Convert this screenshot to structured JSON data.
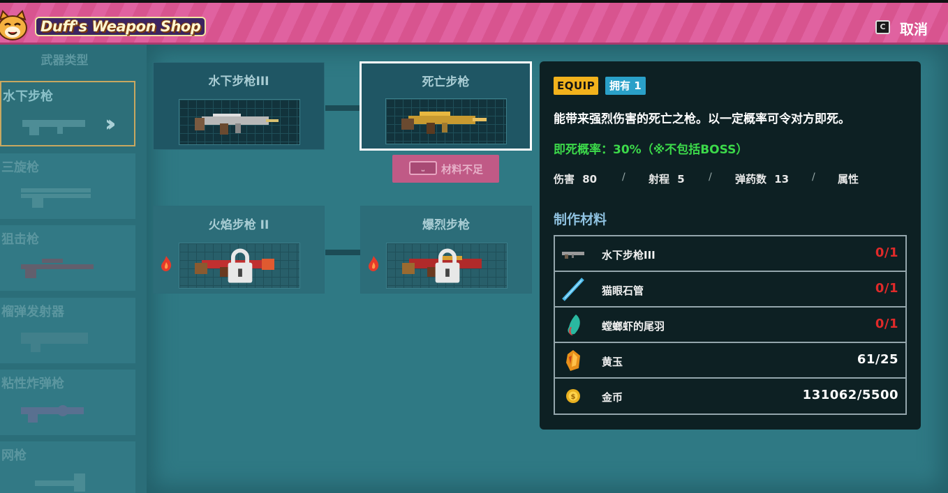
{
  "header": {
    "shop_title": "Duff's Weapon Shop",
    "cancel_key": "C",
    "cancel_label": "取消"
  },
  "sidebar": {
    "title": "武器类型",
    "items": [
      {
        "label": "水下步枪",
        "active": true
      },
      {
        "label": "三旋枪",
        "active": false
      },
      {
        "label": "狙击枪",
        "active": false
      },
      {
        "label": "榴弹发射器",
        "active": false
      },
      {
        "label": "粘性炸弹枪",
        "active": false
      },
      {
        "label": "网枪",
        "active": false
      }
    ]
  },
  "tree": {
    "weapons": [
      {
        "name": "水下步枪III",
        "locked": false,
        "selected": false
      },
      {
        "name": "死亡步枪",
        "locked": false,
        "selected": true
      },
      {
        "name": "火焰步枪 II",
        "locked": true,
        "selected": false
      },
      {
        "name": "爆烈步枪",
        "locked": true,
        "selected": false
      }
    ],
    "craft_button": {
      "key": "⎵",
      "label": "材料不足"
    }
  },
  "detail": {
    "equip_badge": "EQUIP",
    "own_badge": "拥有 1",
    "description": "能带来强烈伤害的死亡之枪。以一定概率可令对方即死。",
    "special": "即死概率：30%（※不包括BOSS）",
    "stats": [
      {
        "label": "伤害",
        "value": "80"
      },
      {
        "label": "射程",
        "value": "5"
      },
      {
        "label": "弹药数",
        "value": "13"
      },
      {
        "label": "属性",
        "value": ""
      }
    ],
    "stat_separator": "/",
    "materials_title": "制作材料",
    "materials": [
      {
        "icon": "rifle-icon",
        "name": "水下步枪III",
        "count": "0/1",
        "short": true
      },
      {
        "icon": "crystal-tube-icon",
        "name": "猫眼石管",
        "count": "0/1",
        "short": true
      },
      {
        "icon": "feather-icon",
        "name": "螳螂虾的尾羽",
        "count": "0/1",
        "short": true
      },
      {
        "icon": "topaz-icon",
        "name": "黄玉",
        "count": "61/25",
        "short": false
      },
      {
        "icon": "coin-icon",
        "name": "金币",
        "count": "131062/5500",
        "short": false
      }
    ]
  },
  "colors": {
    "header_pink": "#d8548f",
    "panel_bg": "#2f7984",
    "detail_bg": "#0d2023",
    "equip_gold": "#f2b21c",
    "own_blue": "#2aa0c8",
    "special_green": "#3cd94a",
    "short_red": "#e02a2a",
    "craft_pink": "#c05a86"
  }
}
